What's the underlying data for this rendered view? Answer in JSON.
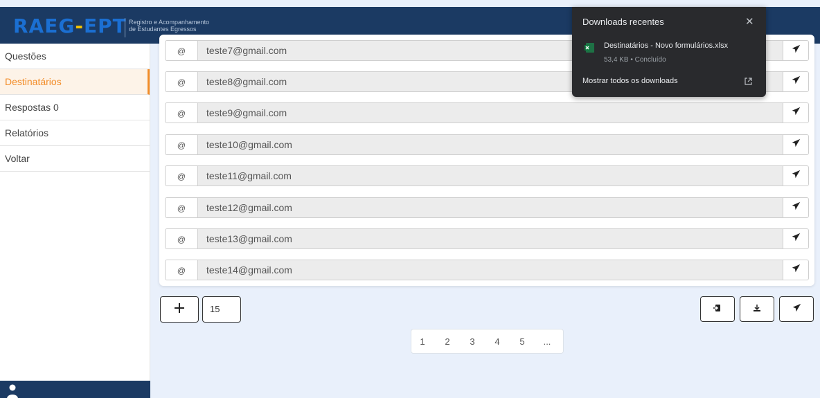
{
  "header": {
    "logo_part1": "RAEG",
    "logo_dash": "-",
    "logo_part2": "EPT",
    "subtitle_line1": "Registro e Acompanhamento",
    "subtitle_line2": "de Estudantes Egressos"
  },
  "sidebar": {
    "items": [
      {
        "label": "Questões"
      },
      {
        "label": "Destinatários"
      },
      {
        "label": "Respostas 0"
      },
      {
        "label": "Relatórios"
      },
      {
        "label": "Voltar"
      }
    ],
    "active_index": 1
  },
  "recipients": {
    "at_symbol": "@",
    "rows": [
      {
        "email": "teste7@gmail.com"
      },
      {
        "email": "teste8@gmail.com"
      },
      {
        "email": "teste9@gmail.com"
      },
      {
        "email": "teste10@gmail.com"
      },
      {
        "email": "teste11@gmail.com"
      },
      {
        "email": "teste12@gmail.com"
      },
      {
        "email": "teste13@gmail.com"
      },
      {
        "email": "teste14@gmail.com"
      }
    ]
  },
  "controls": {
    "count_value": "15"
  },
  "pagination": {
    "pages": [
      "1",
      "2",
      "3",
      "4",
      "5",
      "..."
    ]
  },
  "downloads_popup": {
    "title": "Downloads recentes",
    "file_name": "Destinatários - Novo formulários.xlsx",
    "file_meta": "53,4 KB • Concluído",
    "show_all": "Mostrar todos os downloads"
  },
  "colors": {
    "header_bg": "#1b3a63",
    "accent_orange": "#f28c28",
    "page_bg": "#e9f0fb",
    "popup_bg": "#292a2d"
  }
}
